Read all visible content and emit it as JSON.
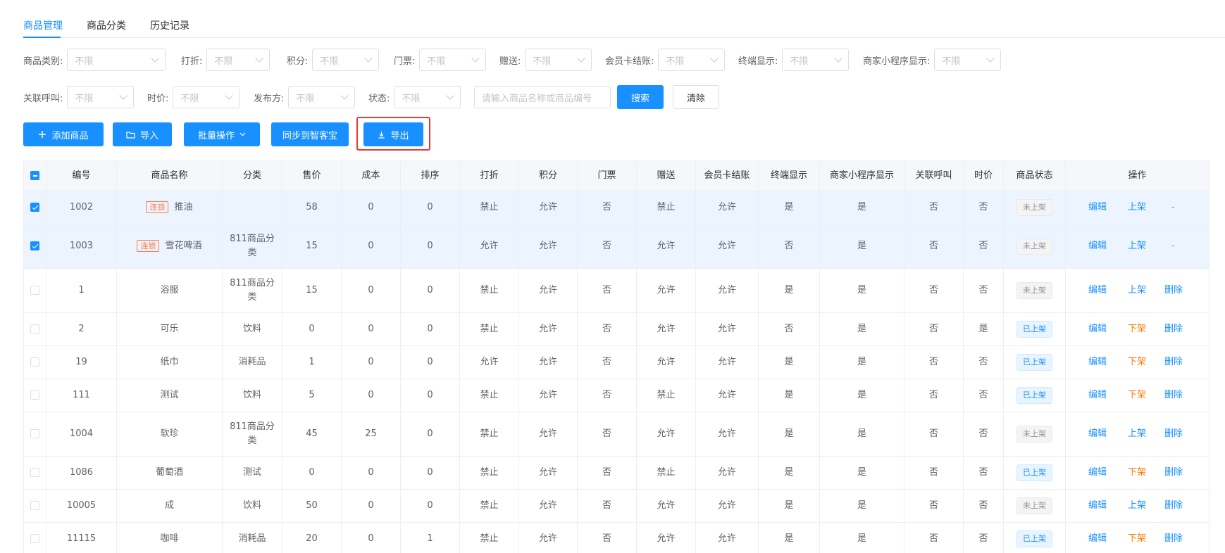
{
  "tabs": [
    {
      "label": "商品管理",
      "active": true
    },
    {
      "label": "商品分类",
      "active": false
    },
    {
      "label": "历史记录",
      "active": false
    }
  ],
  "filters_row1": [
    {
      "label": "商品类别:",
      "value": "不限"
    },
    {
      "label": "打折:",
      "value": "不限"
    },
    {
      "label": "积分:",
      "value": "不限"
    },
    {
      "label": "门票:",
      "value": "不限"
    },
    {
      "label": "赠送:",
      "value": "不限"
    },
    {
      "label": "会员卡结账:",
      "value": "不限"
    },
    {
      "label": "终端显示:",
      "value": "不限"
    },
    {
      "label": "商家小程序显示:",
      "value": "不限"
    }
  ],
  "filters_row2": [
    {
      "label": "关联呼叫:",
      "value": "不限"
    },
    {
      "label": "时价:",
      "value": "不限"
    },
    {
      "label": "发布方:",
      "value": "不限"
    },
    {
      "label": "状态:",
      "value": "不限"
    }
  ],
  "search": {
    "placeholder": "请输入商品名称或商品编号",
    "search_label": "搜索",
    "clear_label": "清除"
  },
  "toolbar": {
    "add_label": "添加商品",
    "import_label": "导入",
    "batch_label": "批量操作",
    "sync_label": "同步到智客宝",
    "export_label": "导出"
  },
  "table": {
    "headers": [
      "编号",
      "商品名称",
      "分类",
      "售价",
      "成本",
      "排序",
      "打折",
      "积分",
      "门票",
      "赠送",
      "会员卡结账",
      "终端显示",
      "商家小程序显示",
      "关联呼叫",
      "时价",
      "商品状态",
      "操作"
    ],
    "ops": {
      "edit": "编辑",
      "delete": "删除"
    },
    "rows": [
      {
        "checked": true,
        "id": "1002",
        "lock": "连锁",
        "name": "推油",
        "category": "",
        "price": "58",
        "cost": "0",
        "sort": "0",
        "discount": "禁止",
        "points": "允许",
        "ticket": "否",
        "gift": "禁止",
        "member_pay": "允许",
        "terminal": "是",
        "miniprogram": "是",
        "call": "否",
        "timeprice": "否",
        "status": "未上架",
        "status_on": false,
        "toggle": "上架",
        "last": "-"
      },
      {
        "checked": true,
        "id": "1003",
        "lock": "连锁",
        "name": "雪花啤酒",
        "category": "811商品分类",
        "price": "15",
        "cost": "0",
        "sort": "0",
        "discount": "允许",
        "points": "允许",
        "ticket": "否",
        "gift": "允许",
        "member_pay": "允许",
        "terminal": "否",
        "miniprogram": "是",
        "call": "否",
        "timeprice": "否",
        "status": "未上架",
        "status_on": false,
        "toggle": "上架",
        "last": "-"
      },
      {
        "checked": false,
        "id": "1",
        "lock": "",
        "name": "浴服",
        "category": "811商品分类",
        "price": "15",
        "cost": "0",
        "sort": "0",
        "discount": "禁止",
        "points": "允许",
        "ticket": "否",
        "gift": "允许",
        "member_pay": "允许",
        "terminal": "是",
        "miniprogram": "是",
        "call": "否",
        "timeprice": "否",
        "status": "未上架",
        "status_on": false,
        "toggle": "上架",
        "last": "删除"
      },
      {
        "checked": false,
        "id": "2",
        "lock": "",
        "name": "可乐",
        "category": "饮料",
        "price": "0",
        "cost": "0",
        "sort": "0",
        "discount": "禁止",
        "points": "允许",
        "ticket": "否",
        "gift": "允许",
        "member_pay": "允许",
        "terminal": "否",
        "miniprogram": "是",
        "call": "否",
        "timeprice": "是",
        "status": "已上架",
        "status_on": true,
        "toggle": "下架",
        "last": "删除"
      },
      {
        "checked": false,
        "id": "19",
        "lock": "",
        "name": "纸巾",
        "category": "消耗品",
        "price": "1",
        "cost": "0",
        "sort": "0",
        "discount": "允许",
        "points": "允许",
        "ticket": "否",
        "gift": "允许",
        "member_pay": "允许",
        "terminal": "是",
        "miniprogram": "是",
        "call": "否",
        "timeprice": "否",
        "status": "已上架",
        "status_on": true,
        "toggle": "下架",
        "last": "删除"
      },
      {
        "checked": false,
        "id": "111",
        "lock": "",
        "name": "测试",
        "category": "饮料",
        "price": "5",
        "cost": "0",
        "sort": "0",
        "discount": "禁止",
        "points": "允许",
        "ticket": "否",
        "gift": "禁止",
        "member_pay": "允许",
        "terminal": "是",
        "miniprogram": "是",
        "call": "否",
        "timeprice": "否",
        "status": "已上架",
        "status_on": true,
        "toggle": "下架",
        "last": "删除"
      },
      {
        "checked": false,
        "id": "1004",
        "lock": "",
        "name": "软珍",
        "category": "811商品分类",
        "price": "45",
        "cost": "25",
        "sort": "0",
        "discount": "禁止",
        "points": "允许",
        "ticket": "否",
        "gift": "允许",
        "member_pay": "允许",
        "terminal": "是",
        "miniprogram": "是",
        "call": "否",
        "timeprice": "否",
        "status": "未上架",
        "status_on": false,
        "toggle": "上架",
        "last": "删除"
      },
      {
        "checked": false,
        "id": "1086",
        "lock": "",
        "name": "葡萄酒",
        "category": "测试",
        "price": "0",
        "cost": "0",
        "sort": "0",
        "discount": "禁止",
        "points": "允许",
        "ticket": "否",
        "gift": "禁止",
        "member_pay": "允许",
        "terminal": "是",
        "miniprogram": "是",
        "call": "否",
        "timeprice": "否",
        "status": "已上架",
        "status_on": true,
        "toggle": "下架",
        "last": "删除"
      },
      {
        "checked": false,
        "id": "10005",
        "lock": "",
        "name": "成",
        "category": "饮料",
        "price": "50",
        "cost": "0",
        "sort": "0",
        "discount": "禁止",
        "points": "允许",
        "ticket": "否",
        "gift": "允许",
        "member_pay": "允许",
        "terminal": "是",
        "miniprogram": "是",
        "call": "否",
        "timeprice": "否",
        "status": "未上架",
        "status_on": false,
        "toggle": "上架",
        "last": "删除"
      },
      {
        "checked": false,
        "id": "11115",
        "lock": "",
        "name": "咖啡",
        "category": "消耗品",
        "price": "20",
        "cost": "0",
        "sort": "1",
        "discount": "禁止",
        "points": "允许",
        "ticket": "否",
        "gift": "允许",
        "member_pay": "允许",
        "terminal": "是",
        "miniprogram": "是",
        "call": "否",
        "timeprice": "否",
        "status": "已上架",
        "status_on": true,
        "toggle": "下架",
        "last": "删除"
      }
    ]
  },
  "colors": {
    "primary": "#1890ff",
    "orange": "#ff7a00",
    "highlight": "#e53935"
  }
}
